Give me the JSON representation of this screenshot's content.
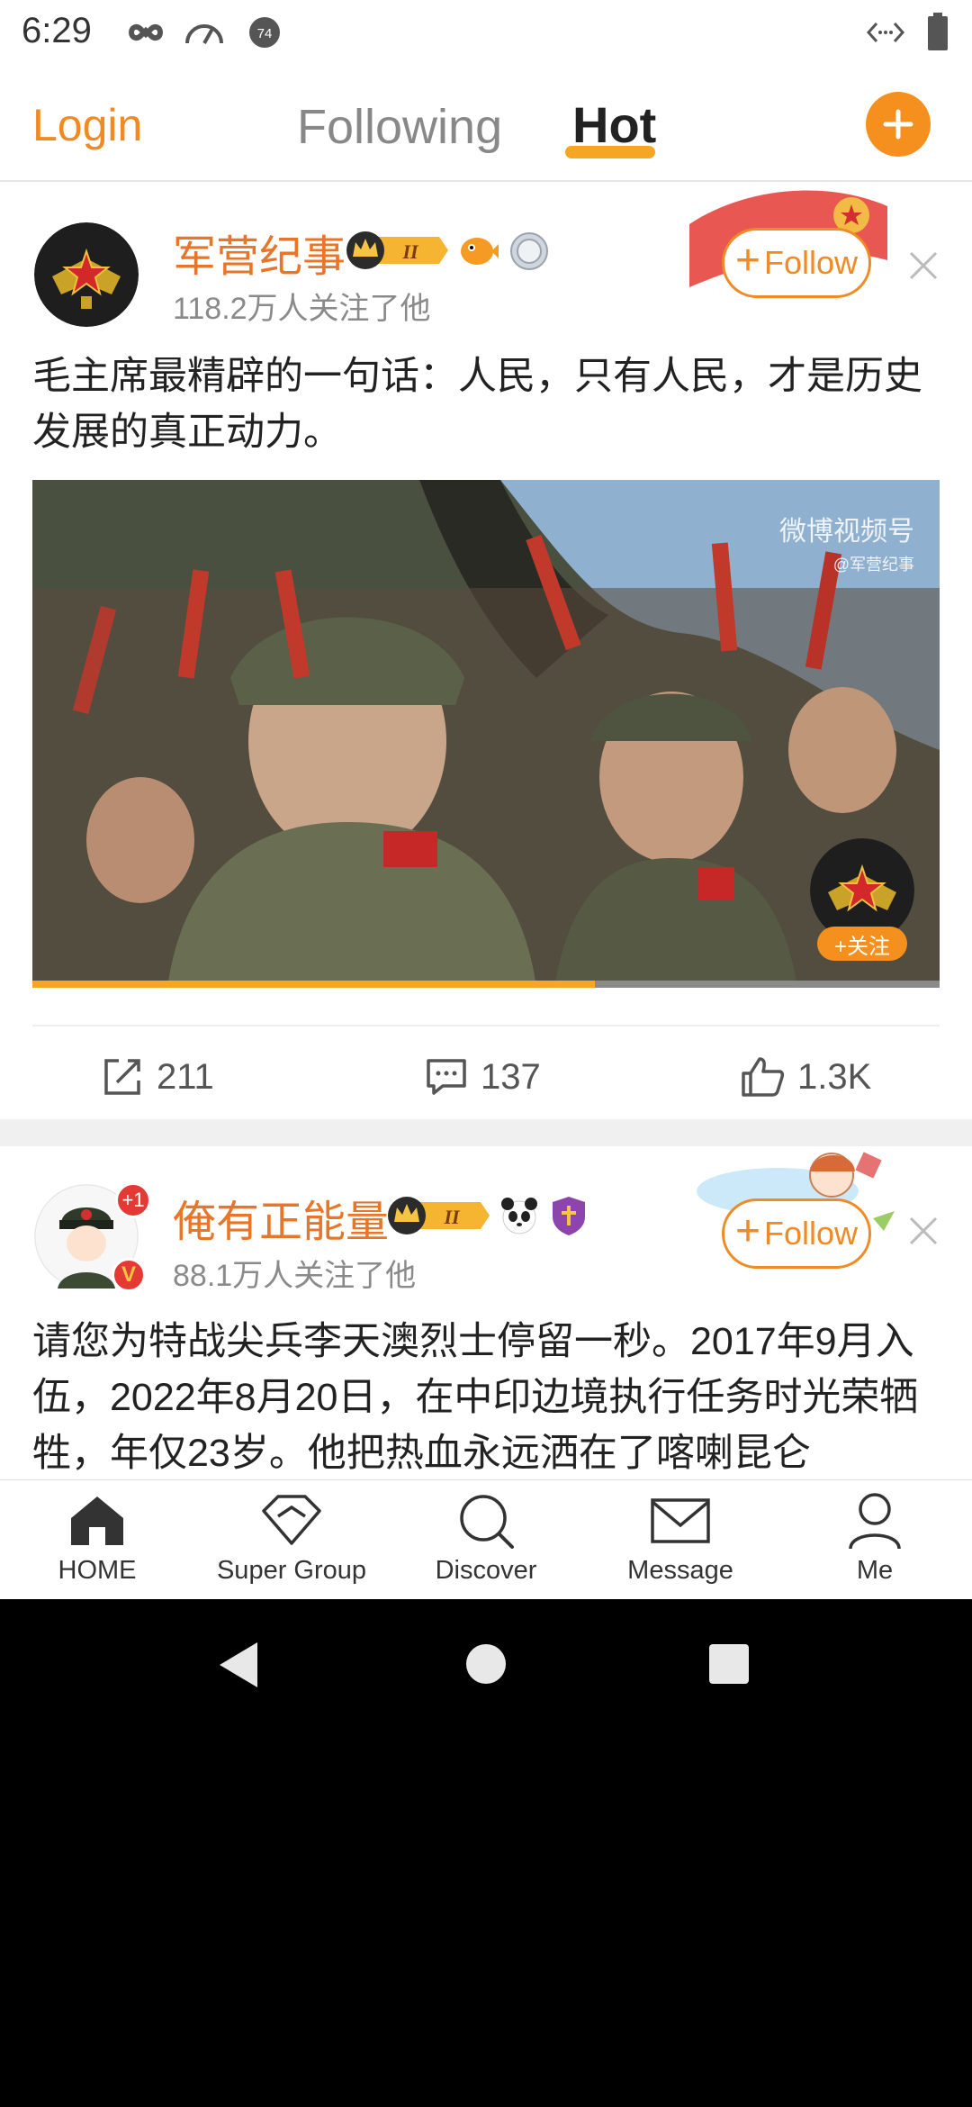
{
  "status_bar": {
    "time": "6:29",
    "icons": [
      "infinity-icon",
      "speedometer-icon",
      "notification-74-icon",
      "data-arrows-icon",
      "battery-icon"
    ],
    "notification_count": "74"
  },
  "top_nav": {
    "login": "Login",
    "tabs": [
      {
        "label": "Following",
        "active": false
      },
      {
        "label": "Hot",
        "active": true
      }
    ],
    "accent_color": "#f5a623"
  },
  "posts": [
    {
      "username": "军营纪事",
      "level_badge": "II",
      "followers": "118.2万人关注了他",
      "follow_label": "Follow",
      "text": "毛主席最精辟的一句话：人民，只有人民，才是历史发展的真正动力。",
      "video": {
        "watermark": "微博视频号",
        "watermark_sub": "@军营纪事",
        "overlay_follow": "+关注",
        "progress": 0.62
      },
      "actions": {
        "repost": "211",
        "comment": "137",
        "like": "1.3K"
      }
    },
    {
      "username": "俺有正能量",
      "level_badge": "II",
      "avatar_badge": "+1",
      "verified": "V",
      "followers": "88.1万人关注了他",
      "follow_label": "Follow",
      "text": "请您为特战尖兵李天澳烈士停留一秒。2017年9月入伍，2022年8月20日，在中印边境执行任务时光荣牺牲，年仅23岁。他把热血永远洒在了喀喇昆仑"
    }
  ],
  "tab_bar": {
    "items": [
      {
        "label": "HOME",
        "icon": "home-icon"
      },
      {
        "label": "Super Group",
        "icon": "diamond-icon"
      },
      {
        "label": "Discover",
        "icon": "search-icon"
      },
      {
        "label": "Message",
        "icon": "mail-icon"
      },
      {
        "label": "Me",
        "icon": "person-icon"
      }
    ]
  }
}
